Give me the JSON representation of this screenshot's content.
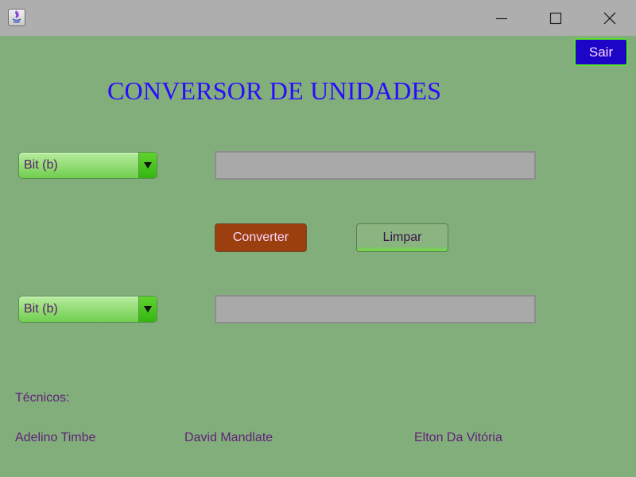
{
  "window": {
    "controls": {
      "minimize_icon": "minimize-icon",
      "maximize_icon": "maximize-icon",
      "close_icon": "close-icon"
    },
    "app_icon": "java-app-icon"
  },
  "header": {
    "exit_label": "Sair",
    "title": "CONVERSOR DE UNIDADES"
  },
  "converter": {
    "from_unit": {
      "selected": "Bit (b)"
    },
    "to_unit": {
      "selected": "Bit (b)"
    },
    "input_value": "",
    "output_value": "",
    "convert_label": "Converter",
    "clear_label": "Limpar"
  },
  "credits": {
    "heading": "Técnicos:",
    "names": [
      "Adelino Timbe",
      "David Mandlate",
      "Elton Da Vitória"
    ]
  },
  "colors": {
    "background": "#82ae7b",
    "titlebar": "#aeaeae",
    "title_text": "#2a0bff",
    "exit_button": "#1c05c6",
    "convert_button": "#9b3f0e",
    "combo_green": "#6fd04b",
    "label_text": "#61217a"
  }
}
